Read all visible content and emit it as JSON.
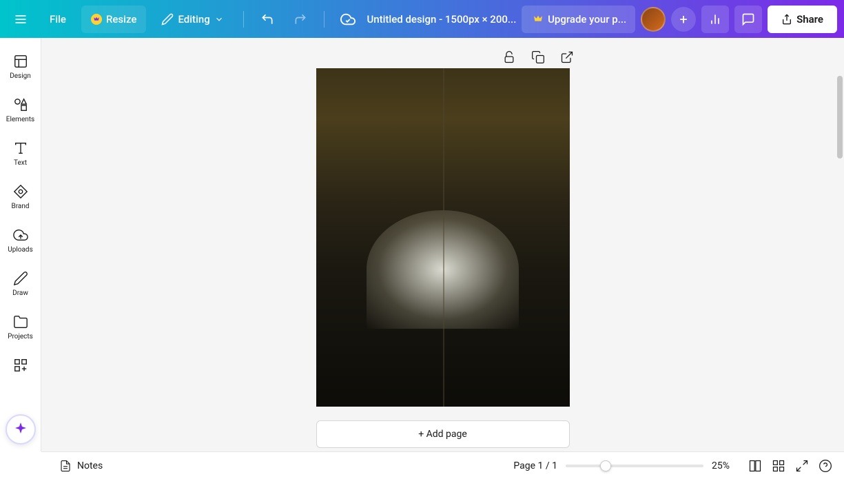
{
  "topbar": {
    "file_label": "File",
    "resize_label": "Resize",
    "editing_label": "Editing",
    "title": "Untitled design - 1500px × 200...",
    "upgrade_label": "Upgrade your p...",
    "share_label": "Share"
  },
  "sidebar": {
    "items": [
      {
        "label": "Design",
        "icon": "layout"
      },
      {
        "label": "Elements",
        "icon": "shapes"
      },
      {
        "label": "Text",
        "icon": "text"
      },
      {
        "label": "Brand",
        "icon": "brand"
      },
      {
        "label": "Uploads",
        "icon": "cloud-upload"
      },
      {
        "label": "Draw",
        "icon": "pencil"
      },
      {
        "label": "Projects",
        "icon": "folder"
      },
      {
        "label": "Apps",
        "icon": "apps"
      }
    ]
  },
  "canvas": {
    "add_page_label": "+ Add page"
  },
  "bottombar": {
    "notes_label": "Notes",
    "page_info": "Page 1 / 1",
    "zoom_value": "25%"
  },
  "colors": {
    "gradient_start": "#00c4cc",
    "gradient_end": "#7d2ae8",
    "accent": "#ffd233"
  }
}
